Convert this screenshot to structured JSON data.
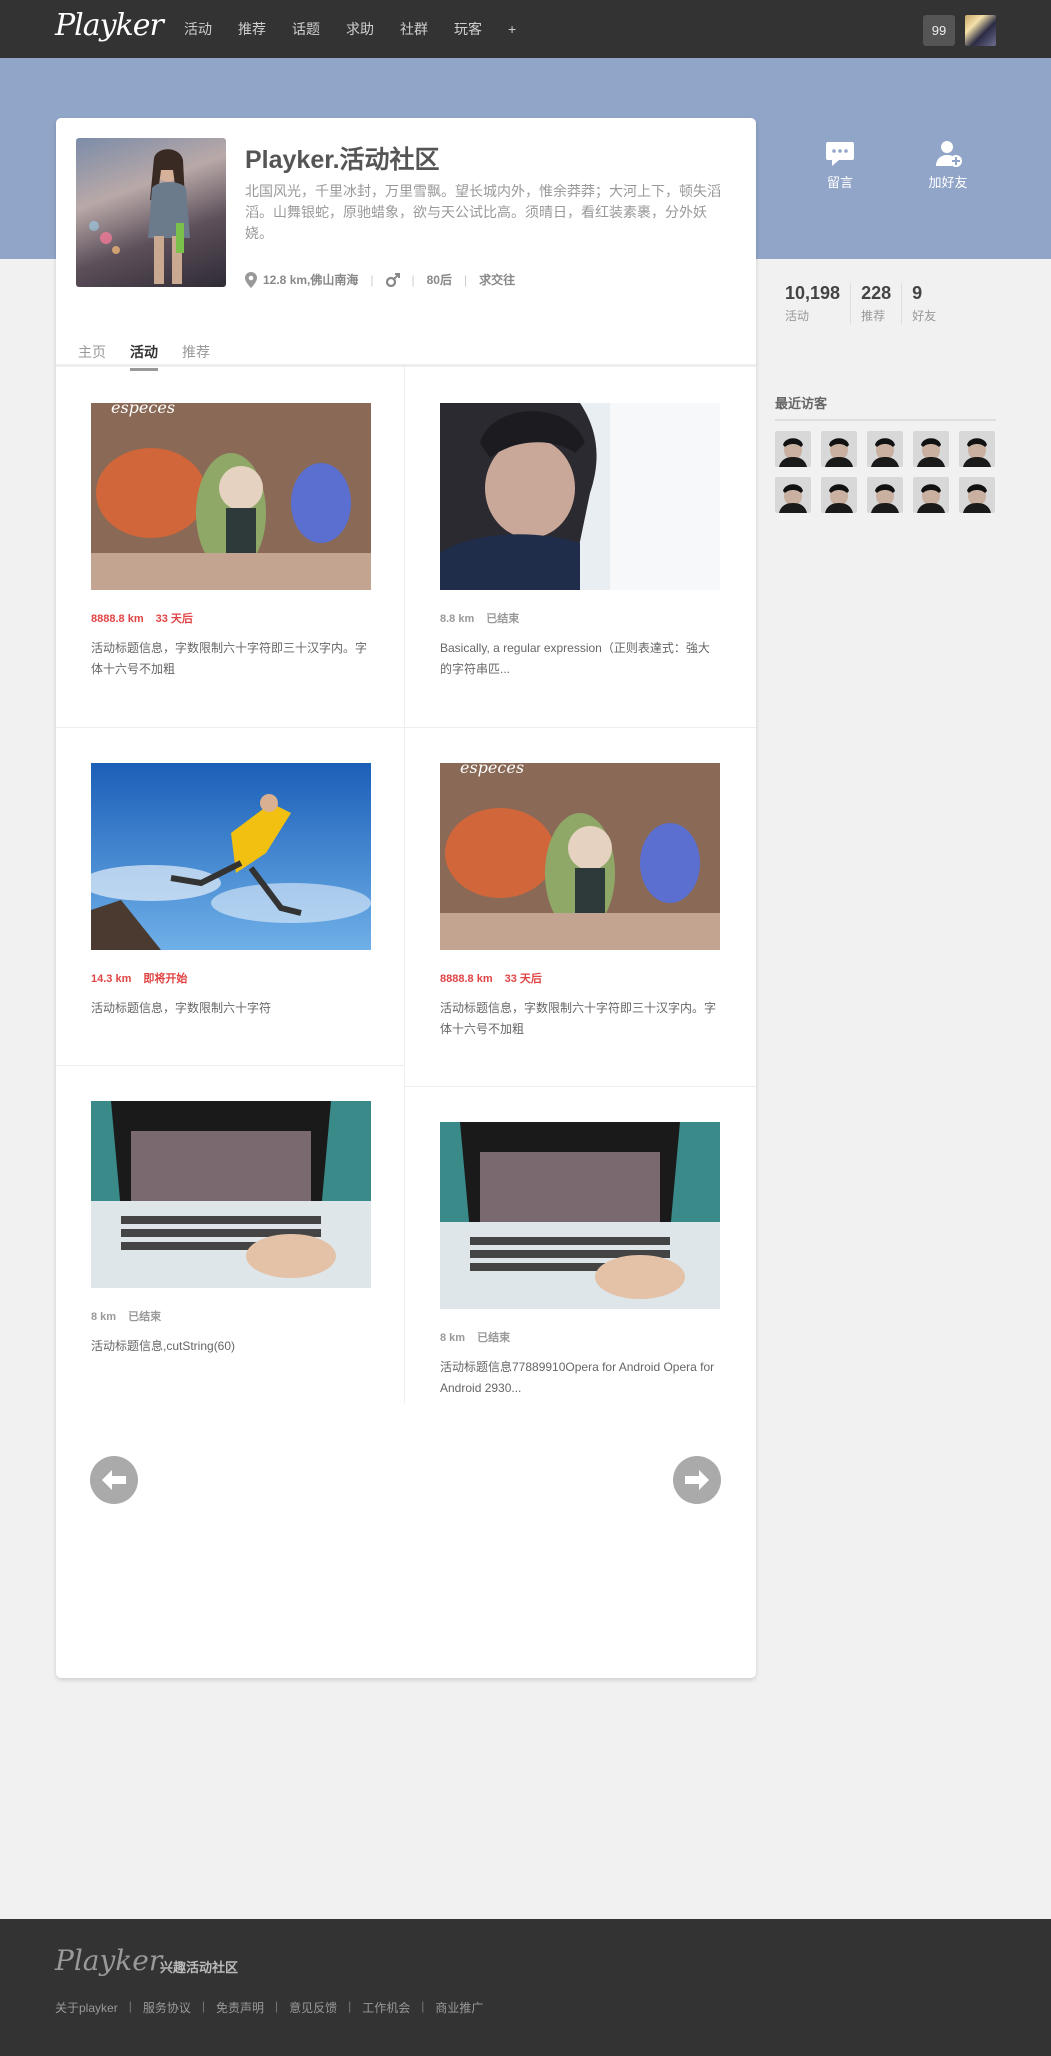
{
  "header": {
    "logo": "Playker",
    "nav": [
      "活动",
      "推荐",
      "话题",
      "求助",
      "社群",
      "玩客",
      "+"
    ],
    "notif_count": "99"
  },
  "banner": {
    "actions": [
      {
        "label": "留言",
        "icon": "comment-icon"
      },
      {
        "label": "加好友",
        "icon": "add-friend-icon"
      }
    ]
  },
  "profile": {
    "name": "Playker.活动社区",
    "description": "北国风光，千里冰封，万里雪飘。望长城内外，惟余莽莽；大河上下，顿失滔滔。山舞银蛇，原驰蜡象，欲与天公试比高。须晴日，看红装素裹，分外妖娆。",
    "distance": "12.8 km,佛山南海",
    "generation": "80后",
    "status": "求交往"
  },
  "tabs": [
    "主页",
    "活动",
    "推荐"
  ],
  "active_tab": "活动",
  "items": [
    {
      "dist": "8888.8 km",
      "status": "33 天后",
      "status_red": true,
      "dist_red": true,
      "title": "活动标题信息，字数限制六十字符即三十汉字内。字体十六号不加粗",
      "image": "toys"
    },
    {
      "dist": "8.8 km",
      "status": "已结束",
      "status_red": false,
      "dist_red": false,
      "title": "Basically, a regular expression（正则表達式：強大的字符串匹...",
      "image": "boy"
    },
    {
      "dist": "14.3 km",
      "status": "即将开始",
      "status_red": true,
      "dist_red": true,
      "title": "活动标题信息，字数限制六十字符",
      "image": "jump"
    },
    {
      "dist": "8888.8 km",
      "status": "33 天后",
      "status_red": true,
      "dist_red": true,
      "title": "活动标题信息，字数限制六十字符即三十汉字内。字体十六号不加粗",
      "image": "toys"
    },
    {
      "dist": "8 km",
      "status": "已结束",
      "status_red": false,
      "dist_red": false,
      "title": "活动标题信息,cutString(60)",
      "image": "laptop"
    },
    {
      "dist": "8 km",
      "status": "已结束",
      "status_red": false,
      "dist_red": false,
      "title": "活动标题信息77889910Opera for Android Opera for Android 2930...",
      "image": "laptop"
    }
  ],
  "stats": [
    {
      "value": "10,198",
      "label": "活动"
    },
    {
      "value": "228",
      "label": "推荐"
    },
    {
      "value": "9",
      "label": "好友"
    }
  ],
  "visitors": {
    "title": "最近访客",
    "count": 10
  },
  "footer": {
    "logo": "Playker",
    "tagline": "兴趣活动社区",
    "links": [
      "关于playker",
      "服务协议",
      "免责声明",
      "意见反馈",
      "工作机会",
      "商业推广"
    ]
  },
  "colors": {
    "topbar": "#333333",
    "banner": "#91a5c8",
    "accent_red": "#e04444"
  }
}
